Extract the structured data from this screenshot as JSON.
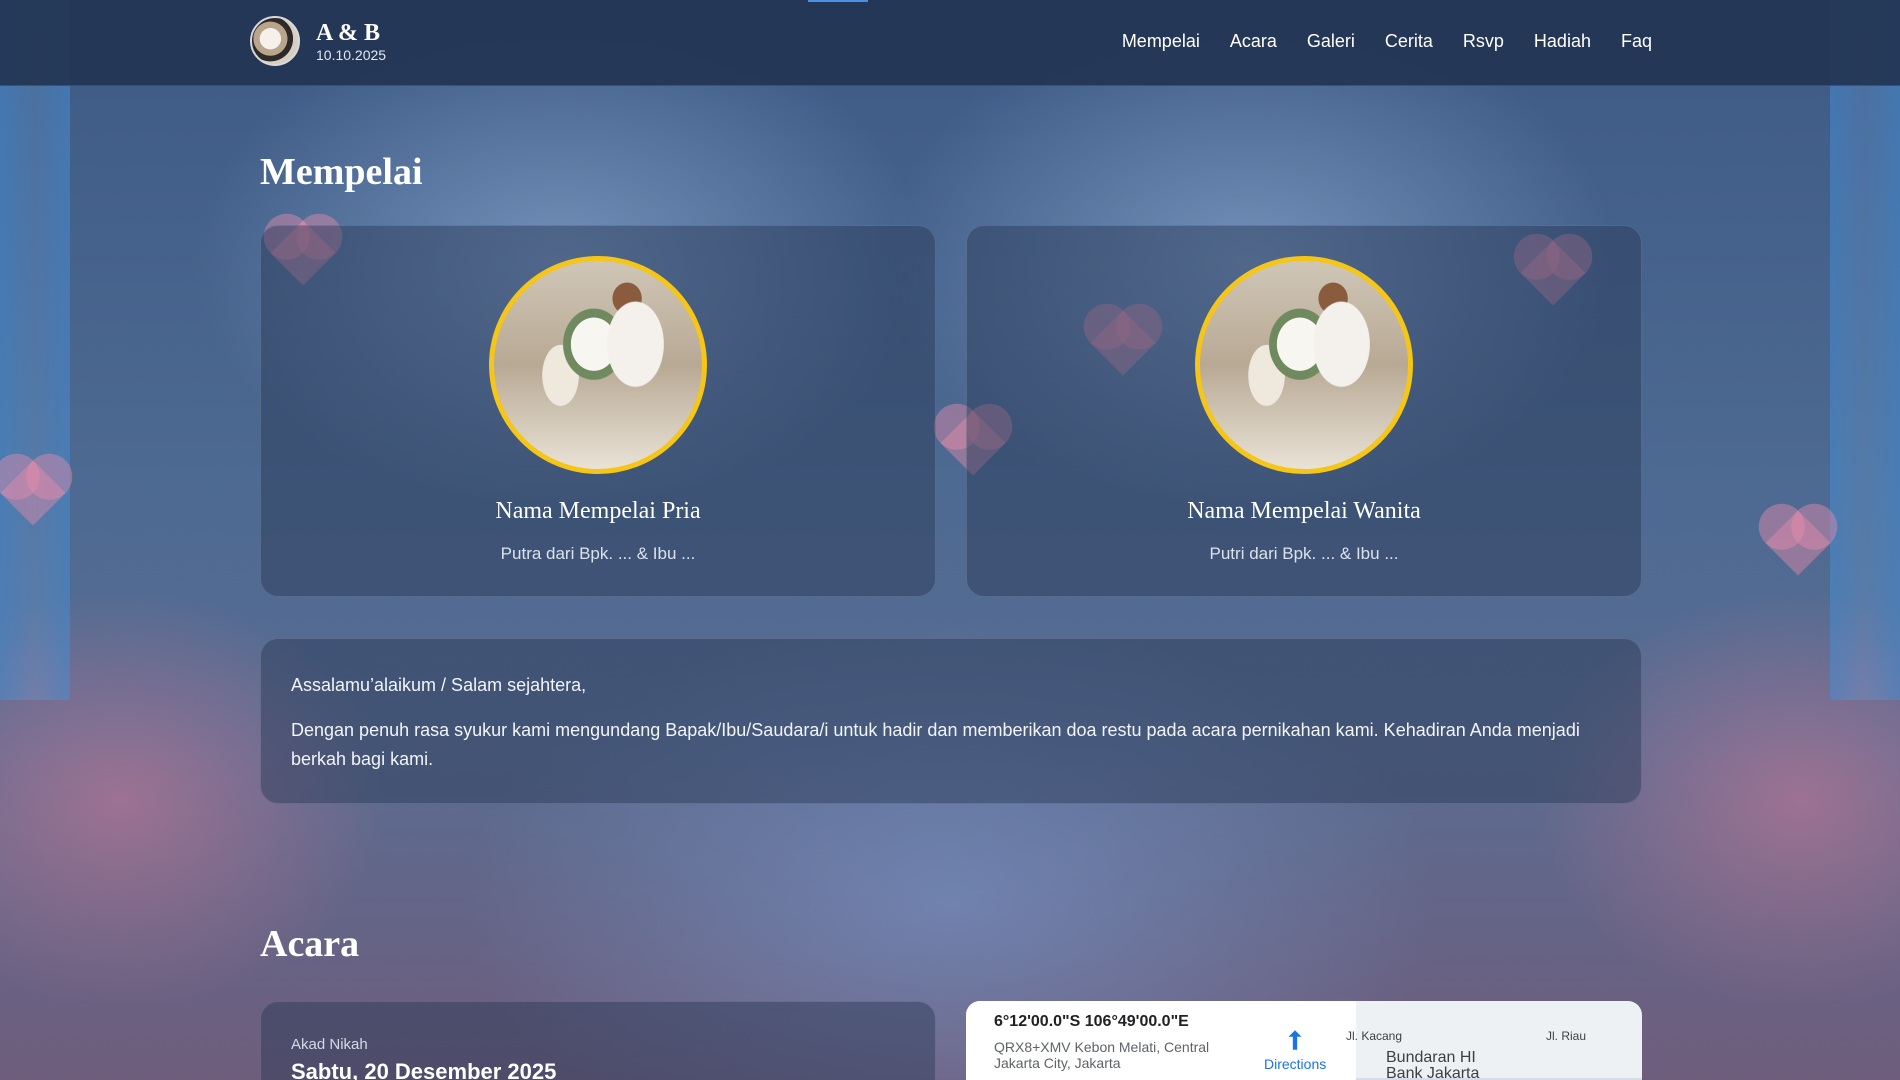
{
  "nav": {
    "brand_title": "A & B",
    "brand_date": "10.10.2025",
    "links": [
      "Mempelai",
      "Acara",
      "Galeri",
      "Cerita",
      "Rsvp",
      "Hadiah",
      "Faq"
    ]
  },
  "mempelai": {
    "title": "Mempelai",
    "groom": {
      "name": "Nama Mempelai Pria",
      "parents": "Putra dari Bpk. ... & Ibu ..."
    },
    "bride": {
      "name": "Nama Mempelai Wanita",
      "parents": "Putri dari Bpk. ... & Ibu ..."
    },
    "greeting": "Assalamu’alaikum / Salam sejahtera,",
    "invitation": "Dengan penuh rasa syukur kami mengundang Bapak/Ibu/Saudara/i untuk hadir dan memberikan doa restu pada acara pernikahan kami. Kehadiran Anda menjadi berkah bagi kami."
  },
  "acara": {
    "title": "Acara",
    "event_label": "Akad Nikah",
    "event_date": "Sabtu, 20 Desember 2025"
  },
  "map": {
    "coords": "6°12'00.0\"S 106°49'00.0\"E",
    "address": "QRX8+XMV Kebon Melati, Central Jakarta City, Jakarta",
    "directions": "Directions",
    "labels": [
      "Bundaran HI",
      "Bank Jakarta",
      "Jl. Kacang",
      "Jl. Riau"
    ]
  },
  "colors": {
    "accent": "#f5c518",
    "nav_bg": "#233452",
    "link_blue": "#1a73e8"
  }
}
